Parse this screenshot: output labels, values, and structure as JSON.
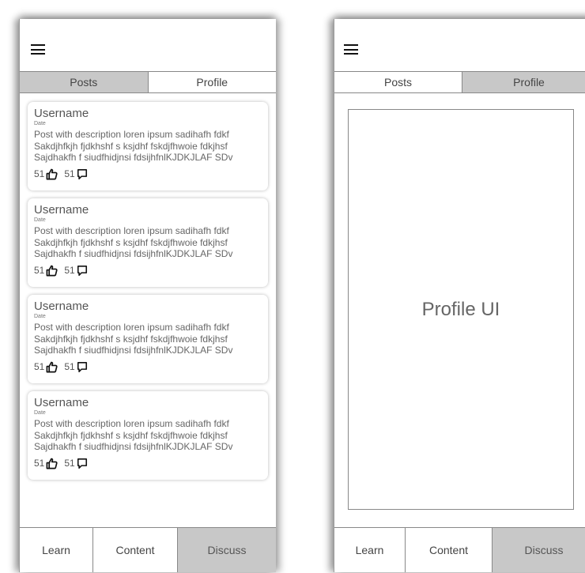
{
  "left_screen": {
    "tabs": [
      {
        "label": "Posts"
      },
      {
        "label": "Profile"
      }
    ],
    "posts": [
      {
        "username": "Username",
        "date": "Date",
        "description": [
          "Post with description loren ipsum sadihafh fdkf",
          "Sakdjhfkjh fjdkhshf s ksjdhf fskdjfhwoie fdkjhsf",
          "Sajdhakfh f siudfhidjnsi fdsijhfnlKJDKJLAF SDv"
        ],
        "likes": "51",
        "comments": "51"
      },
      {
        "username": "Username",
        "date": "Date",
        "description": [
          "Post with description loren ipsum sadihafh fdkf",
          "Sakdjhfkjh fjdkhshf s ksjdhf fskdjfhwoie fdkjhsf",
          "Sajdhakfh f siudfhidjnsi fdsijhfnlKJDKJLAF SDv"
        ],
        "likes": "51",
        "comments": "51"
      },
      {
        "username": "Username",
        "date": "Date",
        "description": [
          "Post with description loren ipsum sadihafh fdkf",
          "Sakdjhfkjh fjdkhshf s ksjdhf fskdjfhwoie fdkjhsf",
          "Sajdhakfh f siudfhidjnsi fdsijhfnlKJDKJLAF SDv"
        ],
        "likes": "51",
        "comments": "51"
      },
      {
        "username": "Username",
        "date": "Date",
        "description": [
          "Post with description loren ipsum sadihafh fdkf",
          "Sakdjhfkjh fjdkhshf s ksjdhf fskdjfhwoie fdkjhsf",
          "Sajdhakfh f siudfhidjnsi fdsijhfnlKJDKJLAF SDv"
        ],
        "likes": "51",
        "comments": "51"
      }
    ],
    "nav": [
      {
        "label": "Learn"
      },
      {
        "label": "Content"
      },
      {
        "label": "Discuss"
      }
    ]
  },
  "right_screen": {
    "tabs": [
      {
        "label": "Posts"
      },
      {
        "label": "Profile"
      }
    ],
    "profile_placeholder": "Profile UI",
    "nav": [
      {
        "label": "Learn"
      },
      {
        "label": "Content"
      },
      {
        "label": "Discuss"
      }
    ]
  },
  "icons": {
    "menu": "hamburger-icon",
    "like": "thumbs-up-icon",
    "comment": "comment-bubble-icon"
  },
  "colors": {
    "selected_gray": "#c8c8c8",
    "border": "#888888",
    "text": "#444444"
  }
}
